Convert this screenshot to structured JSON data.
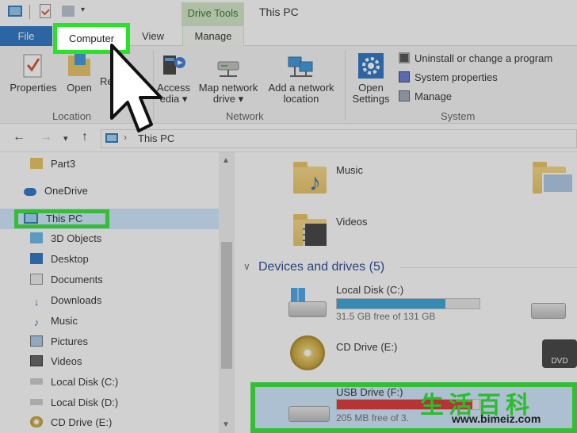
{
  "window": {
    "title": "This PC",
    "context_tab_header": "Drive Tools"
  },
  "tabs": {
    "file": "File",
    "computer": "Computer",
    "view": "View",
    "manage": "Manage"
  },
  "ribbon": {
    "location": {
      "label": "Location",
      "properties": "Properties",
      "open": "Open",
      "rename": "Re"
    },
    "network": {
      "label": "Network",
      "access_media_l1": "Access",
      "access_media_l2": "edia",
      "map_drive_l1": "Map network",
      "map_drive_l2": "drive",
      "add_location_l1": "Add a network",
      "add_location_l2": "location"
    },
    "system": {
      "label": "System",
      "open_settings_l1": "Open",
      "open_settings_l2": "Settings",
      "uninstall": "Uninstall or change a program",
      "system_properties": "System properties",
      "manage": "Manage"
    }
  },
  "address": {
    "path": "This PC"
  },
  "nav": {
    "items": [
      {
        "label": "Part3",
        "icon": "folder-icon"
      },
      {
        "label": "OneDrive",
        "icon": "cloud-icon"
      },
      {
        "label": "This PC",
        "icon": "computer-icon"
      },
      {
        "label": "3D Objects",
        "icon": "cube-icon"
      },
      {
        "label": "Desktop",
        "icon": "desktop-icon"
      },
      {
        "label": "Documents",
        "icon": "document-icon"
      },
      {
        "label": "Downloads",
        "icon": "download-icon"
      },
      {
        "label": "Music",
        "icon": "music-icon"
      },
      {
        "label": "Pictures",
        "icon": "picture-icon"
      },
      {
        "label": "Videos",
        "icon": "video-icon"
      },
      {
        "label": "Local Disk (C:)",
        "icon": "drive-icon"
      },
      {
        "label": "Local Disk (D:)",
        "icon": "drive-icon"
      },
      {
        "label": "CD Drive (E:)",
        "icon": "cd-icon"
      }
    ]
  },
  "content": {
    "folders": [
      {
        "label": "Music"
      },
      {
        "label": "Videos"
      }
    ],
    "section_title": "Devices and drives (5)",
    "drives": [
      {
        "label": "Local Disk (C:)",
        "free": "31.5 GB free of 131 GB",
        "used_fraction": 0.76,
        "color": "#26a0da"
      },
      {
        "label": "CD Drive (E:)"
      },
      {
        "label": "USB Drive (F:)",
        "free": "205 MB free of 3.",
        "used_fraction": 0.95,
        "color": "#da2626"
      }
    ]
  },
  "watermark": {
    "text": "生活百科",
    "url": "www.bimeiz.com"
  }
}
